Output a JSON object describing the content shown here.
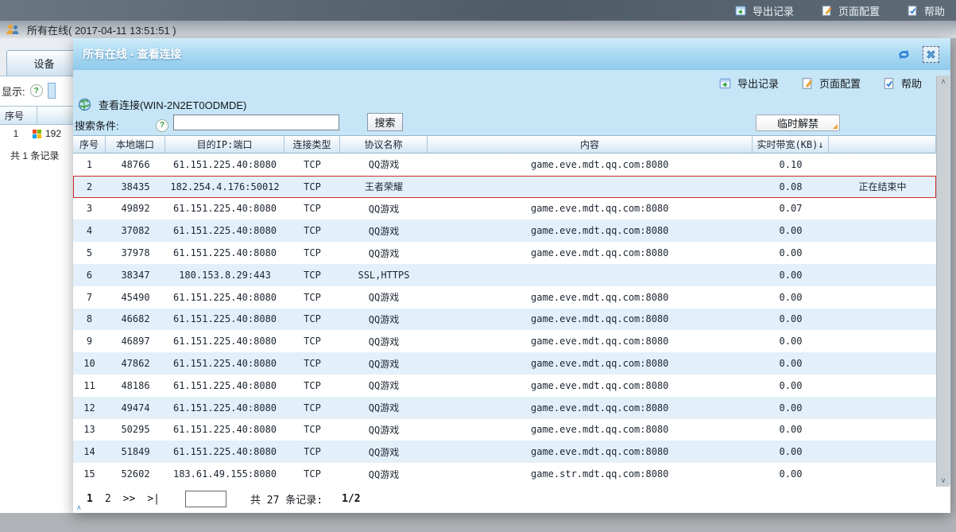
{
  "icons": {
    "question": "?",
    "collapse": "∧",
    "scroll_up": "∧",
    "scroll_down": "∨"
  },
  "topbar": {
    "export": "导出记录",
    "config": "页面配置",
    "help": "帮助"
  },
  "page": {
    "title": "所有在线( 2017-04-11 13:51:51 )",
    "tab": "设备",
    "display_label": "显示:",
    "mini_table": {
      "header": "序号",
      "row_no": "1",
      "row_ip": "192",
      "summary": "共 1 条记录"
    }
  },
  "dialog": {
    "title": "所有在线 - 查看连接",
    "toolbar": {
      "export": "导出记录",
      "config": "页面配置",
      "help": "帮助"
    },
    "subtitle": "查看连接(WIN-2N2ET0ODMDE)",
    "search": {
      "label": "搜索条件:",
      "input_value": "",
      "button": "搜索",
      "unblock": "临时解禁"
    },
    "table": {
      "columns": [
        "序号",
        "本地端口",
        "目的IP:端口",
        "连接类型",
        "协议名称",
        "内容",
        "实时带宽(KB)↓",
        ""
      ],
      "rows": [
        {
          "no": "1",
          "port": "48766",
          "dest": "61.151.225.40:8080",
          "type": "TCP",
          "proto": "QQ游戏",
          "content": "game.eve.mdt.qq.com:8080",
          "bw": "0.10",
          "status": "",
          "highlighted": false
        },
        {
          "no": "2",
          "port": "38435",
          "dest": "182.254.4.176:50012",
          "type": "TCP",
          "proto": "王者荣耀",
          "content": "",
          "bw": "0.08",
          "status": "正在结束中",
          "highlighted": true
        },
        {
          "no": "3",
          "port": "49892",
          "dest": "61.151.225.40:8080",
          "type": "TCP",
          "proto": "QQ游戏",
          "content": "game.eve.mdt.qq.com:8080",
          "bw": "0.07",
          "status": "",
          "highlighted": false
        },
        {
          "no": "4",
          "port": "37082",
          "dest": "61.151.225.40:8080",
          "type": "TCP",
          "proto": "QQ游戏",
          "content": "game.eve.mdt.qq.com:8080",
          "bw": "0.00",
          "status": "",
          "highlighted": false
        },
        {
          "no": "5",
          "port": "37978",
          "dest": "61.151.225.40:8080",
          "type": "TCP",
          "proto": "QQ游戏",
          "content": "game.eve.mdt.qq.com:8080",
          "bw": "0.00",
          "status": "",
          "highlighted": false
        },
        {
          "no": "6",
          "port": "38347",
          "dest": "180.153.8.29:443",
          "type": "TCP",
          "proto": "SSL,HTTPS",
          "content": "",
          "bw": "0.00",
          "status": "",
          "highlighted": false
        },
        {
          "no": "7",
          "port": "45490",
          "dest": "61.151.225.40:8080",
          "type": "TCP",
          "proto": "QQ游戏",
          "content": "game.eve.mdt.qq.com:8080",
          "bw": "0.00",
          "status": "",
          "highlighted": false
        },
        {
          "no": "8",
          "port": "46682",
          "dest": "61.151.225.40:8080",
          "type": "TCP",
          "proto": "QQ游戏",
          "content": "game.eve.mdt.qq.com:8080",
          "bw": "0.00",
          "status": "",
          "highlighted": false
        },
        {
          "no": "9",
          "port": "46897",
          "dest": "61.151.225.40:8080",
          "type": "TCP",
          "proto": "QQ游戏",
          "content": "game.eve.mdt.qq.com:8080",
          "bw": "0.00",
          "status": "",
          "highlighted": false
        },
        {
          "no": "10",
          "port": "47862",
          "dest": "61.151.225.40:8080",
          "type": "TCP",
          "proto": "QQ游戏",
          "content": "game.eve.mdt.qq.com:8080",
          "bw": "0.00",
          "status": "",
          "highlighted": false
        },
        {
          "no": "11",
          "port": "48186",
          "dest": "61.151.225.40:8080",
          "type": "TCP",
          "proto": "QQ游戏",
          "content": "game.eve.mdt.qq.com:8080",
          "bw": "0.00",
          "status": "",
          "highlighted": false
        },
        {
          "no": "12",
          "port": "49474",
          "dest": "61.151.225.40:8080",
          "type": "TCP",
          "proto": "QQ游戏",
          "content": "game.eve.mdt.qq.com:8080",
          "bw": "0.00",
          "status": "",
          "highlighted": false
        },
        {
          "no": "13",
          "port": "50295",
          "dest": "61.151.225.40:8080",
          "type": "TCP",
          "proto": "QQ游戏",
          "content": "game.eve.mdt.qq.com:8080",
          "bw": "0.00",
          "status": "",
          "highlighted": false
        },
        {
          "no": "14",
          "port": "51849",
          "dest": "61.151.225.40:8080",
          "type": "TCP",
          "proto": "QQ游戏",
          "content": "game.eve.mdt.qq.com:8080",
          "bw": "0.00",
          "status": "",
          "highlighted": false
        },
        {
          "no": "15",
          "port": "52602",
          "dest": "183.61.49.155:8080",
          "type": "TCP",
          "proto": "QQ游戏",
          "content": "game.str.mdt.qq.com:8080",
          "bw": "0.00",
          "status": "",
          "highlighted": false
        }
      ]
    },
    "pagination": {
      "current": "1",
      "page2": "2",
      "next": ">>",
      "last": ">|",
      "input_value": "",
      "total": "共 27 条记录:",
      "indicator": "1/2"
    }
  }
}
